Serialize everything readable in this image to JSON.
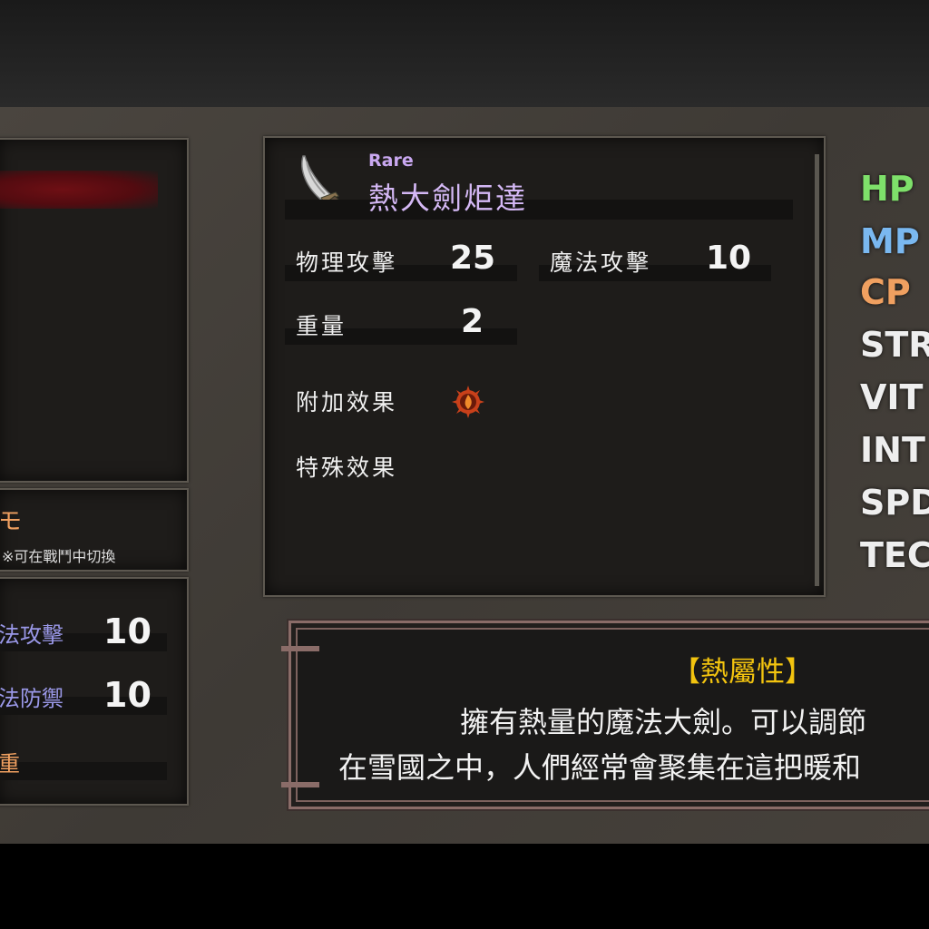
{
  "left_panel": {
    "mode_label": "モ",
    "switch_note": "※可在戰鬥中切換",
    "stats": [
      {
        "label": "法攻擊",
        "value": "10"
      },
      {
        "label": "法防禦",
        "value": "10"
      }
    ],
    "weight_label": "重"
  },
  "item": {
    "rarity": "Rare",
    "name": "熱大劍炬達",
    "physical_attack_label": "物理攻擊",
    "physical_attack_value": "25",
    "magic_attack_label": "魔法攻擊",
    "magic_attack_value": "10",
    "weight_label": "重量",
    "weight_value": "2",
    "extra_effect_label": "附加效果",
    "special_effect_label": "特殊效果",
    "icon": "greatsword-icon",
    "extra_effect_icon": "fire-element-icon"
  },
  "character_stats": [
    {
      "label": "HP",
      "color": "#7ee06a"
    },
    {
      "label": "MP",
      "color": "#7ab8f0"
    },
    {
      "label": "CP",
      "color": "#f0a060"
    },
    {
      "label": "STR",
      "color": "#f2f2f2"
    },
    {
      "label": "VIT",
      "color": "#f2f2f2"
    },
    {
      "label": "INT",
      "color": "#f2f2f2"
    },
    {
      "label": "SPD",
      "color": "#f2f2f2"
    },
    {
      "label": "TEC",
      "color": "#f2f2f2"
    }
  ],
  "description": {
    "attribute": "【熱屬性】",
    "line1": "擁有熱量的魔法大劍。可以調節",
    "line2": "在雪國之中，人們經常會聚集在這把暖和"
  },
  "colors": {
    "rarity": "#c9a8f0",
    "attribute": "#f3c40f",
    "magic_stat": "#9a98e8",
    "orange_stat": "#f0a060"
  }
}
